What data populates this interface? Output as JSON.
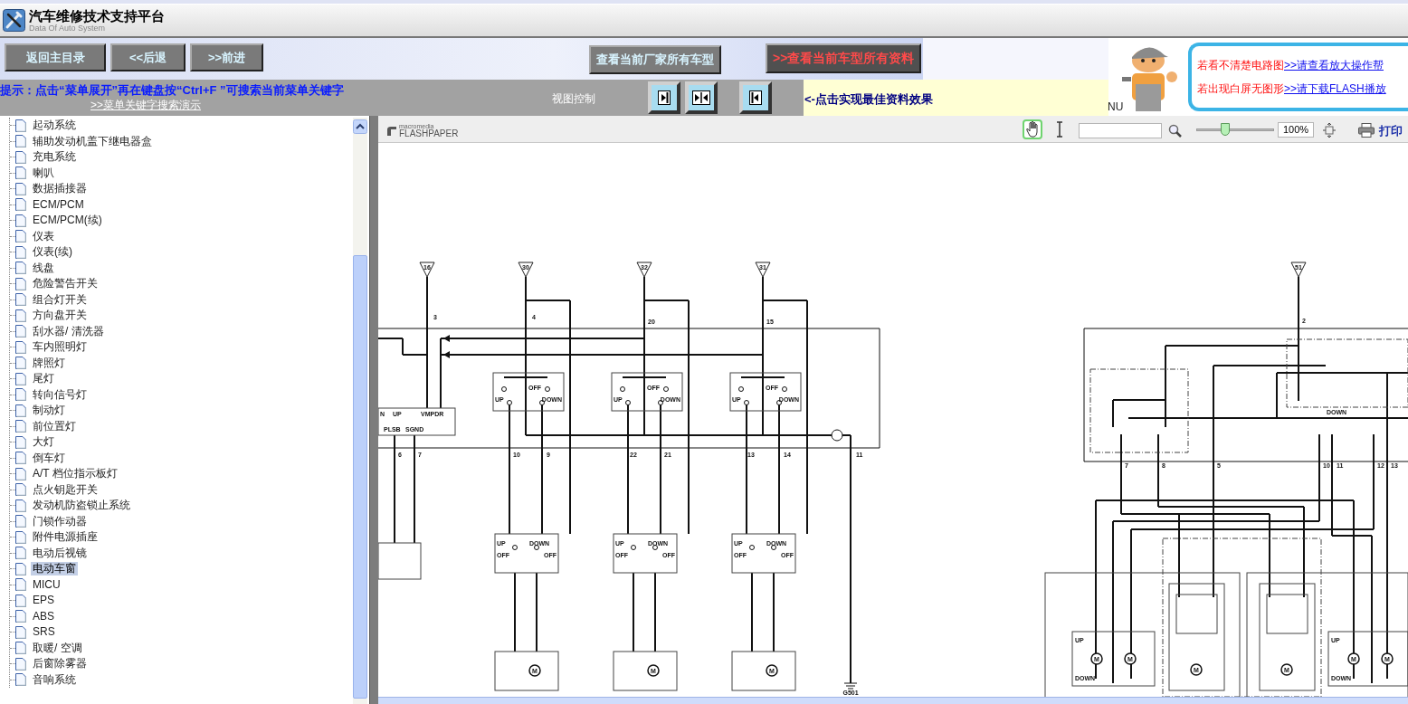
{
  "app": {
    "title": "汽车维修技术支持平台",
    "subtitle": "Data Of Auto System"
  },
  "nav_buttons": [
    {
      "label": "返回主目录"
    },
    {
      "label": "<<后退"
    },
    {
      "label": ">>前进"
    }
  ],
  "maker_button": {
    "label": "查看当前厂家所有车型"
  },
  "model_button": {
    "label": ">>查看当前车型所有资料"
  },
  "hint": {
    "text": "提示：点击“菜单展开”再在键盘按“Ctrl+F ”可搜索当前菜单关键字",
    "link": ">>菜单关键字搜索演示"
  },
  "view_control": {
    "label": "视图控制",
    "buttons": [
      {
        "kind": "arrow-right"
      },
      {
        "kind": "arrows-inward"
      },
      {
        "kind": "arrow-left"
      }
    ],
    "tip": "<-点击实现最佳资料效果",
    "cut_text": "NU"
  },
  "help_box": {
    "lines": [
      {
        "text": "若看不清楚电路图",
        "link": ">>请查看放大操作帮"
      },
      {
        "text": "若出现白屏无图形",
        "link": ">>请下载FLASH播放"
      }
    ]
  },
  "sidebar": {
    "items": [
      {
        "label": "起动系统",
        "selected": false
      },
      {
        "label": "辅助发动机盖下继电器盒",
        "selected": false
      },
      {
        "label": "充电系统",
        "selected": false
      },
      {
        "label": "喇叭",
        "selected": false
      },
      {
        "label": "数据插接器",
        "selected": false
      },
      {
        "label": "ECM/PCM",
        "selected": false
      },
      {
        "label": "ECM/PCM(续)",
        "selected": false
      },
      {
        "label": "仪表",
        "selected": false
      },
      {
        "label": "仪表(续)",
        "selected": false
      },
      {
        "label": "线盘",
        "selected": false
      },
      {
        "label": "危险警告开关",
        "selected": false
      },
      {
        "label": "组合灯开关",
        "selected": false
      },
      {
        "label": "方向盘开关",
        "selected": false
      },
      {
        "label": "刮水器/ 清洗器",
        "selected": false
      },
      {
        "label": "车内照明灯",
        "selected": false
      },
      {
        "label": "牌照灯",
        "selected": false
      },
      {
        "label": "尾灯",
        "selected": false
      },
      {
        "label": "转向信号灯",
        "selected": false
      },
      {
        "label": "制动灯",
        "selected": false
      },
      {
        "label": "前位置灯",
        "selected": false
      },
      {
        "label": "大灯",
        "selected": false
      },
      {
        "label": "倒车灯",
        "selected": false
      },
      {
        "label": "A/T 档位指示板灯",
        "selected": false
      },
      {
        "label": "点火钥匙开关",
        "selected": false
      },
      {
        "label": "发动机防盗锁止系统",
        "selected": false
      },
      {
        "label": "门锁作动器",
        "selected": false
      },
      {
        "label": "附件电源插座",
        "selected": false
      },
      {
        "label": "电动后视镜",
        "selected": false
      },
      {
        "label": "电动车窗",
        "selected": true
      },
      {
        "label": "MICU",
        "selected": false
      },
      {
        "label": "EPS",
        "selected": false
      },
      {
        "label": "ABS",
        "selected": false
      },
      {
        "label": "SRS",
        "selected": false
      },
      {
        "label": "取暖/ 空调",
        "selected": false
      },
      {
        "label": "后窗除雾器",
        "selected": false
      },
      {
        "label": "音响系统",
        "selected": false
      }
    ]
  },
  "viewer": {
    "brand_top": "macromedia",
    "brand": "FLASHPAPER",
    "tools": [
      {
        "kind": "hand",
        "selected": true
      },
      {
        "kind": "text-select",
        "selected": false
      }
    ],
    "zoom": {
      "level": 0.35,
      "value": "100%"
    },
    "print": "打印"
  },
  "diagram": {
    "fuses": [
      "16",
      "30",
      "32",
      "31",
      "51"
    ],
    "master_switches": [
      {
        "up": "UP",
        "off": "OFF",
        "down": "DOWN"
      },
      {
        "up": "UP",
        "off": "OFF",
        "down": "DOWN"
      },
      {
        "up": "UP",
        "off": "OFF",
        "down": "DOWN"
      }
    ],
    "window_switches": [
      {
        "up": "UP",
        "down": "DOWN",
        "off_left": "OFF",
        "off_right": "OFF"
      },
      {
        "up": "UP",
        "down": "DOWN",
        "off_left": "OFF",
        "off_right": "OFF"
      },
      {
        "up": "UP",
        "down": "DOWN",
        "off_left": "OFF",
        "off_right": "OFF"
      }
    ],
    "module_pins": [
      "N",
      "UP",
      "VMPDR",
      "PLSB",
      "SGND"
    ],
    "wire_numbers": [
      "3",
      "4",
      "20",
      "15",
      "6",
      "7",
      "10",
      "9",
      "22",
      "21",
      "13",
      "14",
      "11",
      "2",
      "7",
      "8",
      "5",
      "10",
      "11",
      "12",
      "13"
    ],
    "ground": "G501",
    "mirror_switch_label": "DOWN",
    "mirror_labels": [
      "UP",
      "DOWN",
      "UP",
      "DOWN"
    ],
    "motors": [
      "M",
      "M",
      "M",
      "M",
      "M",
      "M",
      "M",
      "M",
      "M"
    ]
  }
}
